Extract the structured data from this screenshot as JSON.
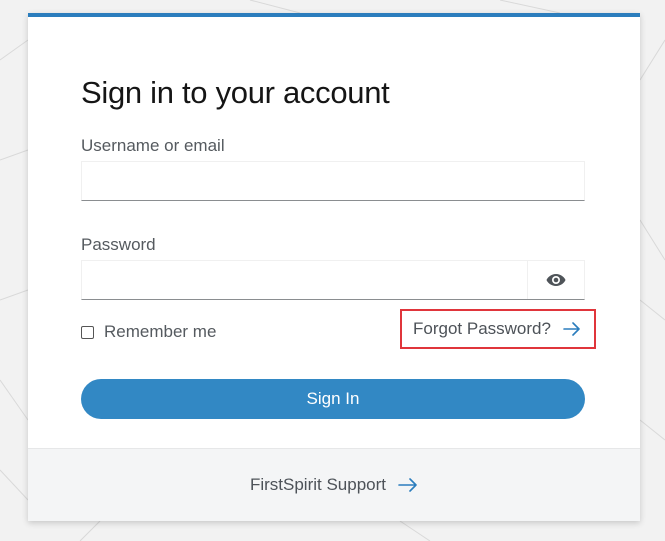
{
  "login": {
    "title": "Sign in to your account",
    "username_label": "Username or email",
    "username_value": "",
    "password_label": "Password",
    "password_value": "",
    "password_toggle_icon": "eye-icon",
    "remember_label": "Remember me",
    "remember_checked": false,
    "forgot_label": "Forgot Password?",
    "signin_label": "Sign In"
  },
  "footer": {
    "support_label": "FirstSpirit Support"
  },
  "colors": {
    "accent": "#2b7dbd",
    "button": "#3288c4",
    "highlight_border": "#e0353b"
  }
}
